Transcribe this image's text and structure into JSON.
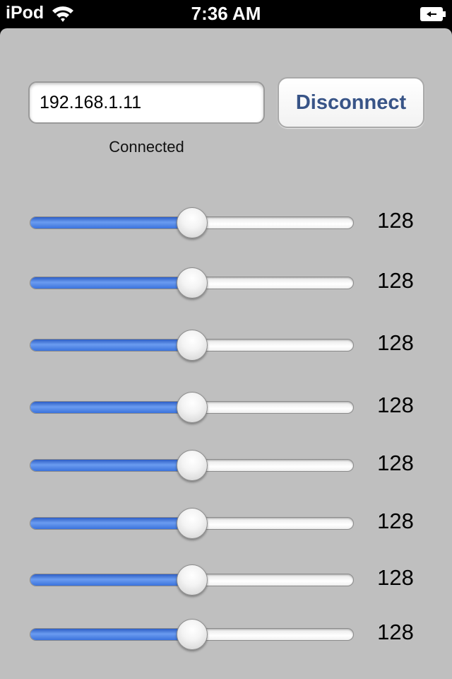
{
  "statusbar": {
    "carrier": "iPod",
    "time": "7:36 AM",
    "wifi_icon": "wifi-icon",
    "battery_icon": "battery-charging-icon"
  },
  "connection": {
    "ip_value": "192.168.1.11",
    "button_label": "Disconnect",
    "status": "Connected"
  },
  "sliders": {
    "max": 255,
    "items": [
      {
        "value": "128",
        "level": 0.5
      },
      {
        "value": "128",
        "level": 0.5
      },
      {
        "value": "128",
        "level": 0.5
      },
      {
        "value": "128",
        "level": 0.5
      },
      {
        "value": "128",
        "level": 0.5
      },
      {
        "value": "128",
        "level": 0.5
      },
      {
        "value": "128",
        "level": 0.5
      },
      {
        "value": "128",
        "level": 0.5
      }
    ]
  },
  "colors": {
    "background": "#bfbfbf",
    "slider_fill": "#3b73dc",
    "button_text": "#385487"
  }
}
